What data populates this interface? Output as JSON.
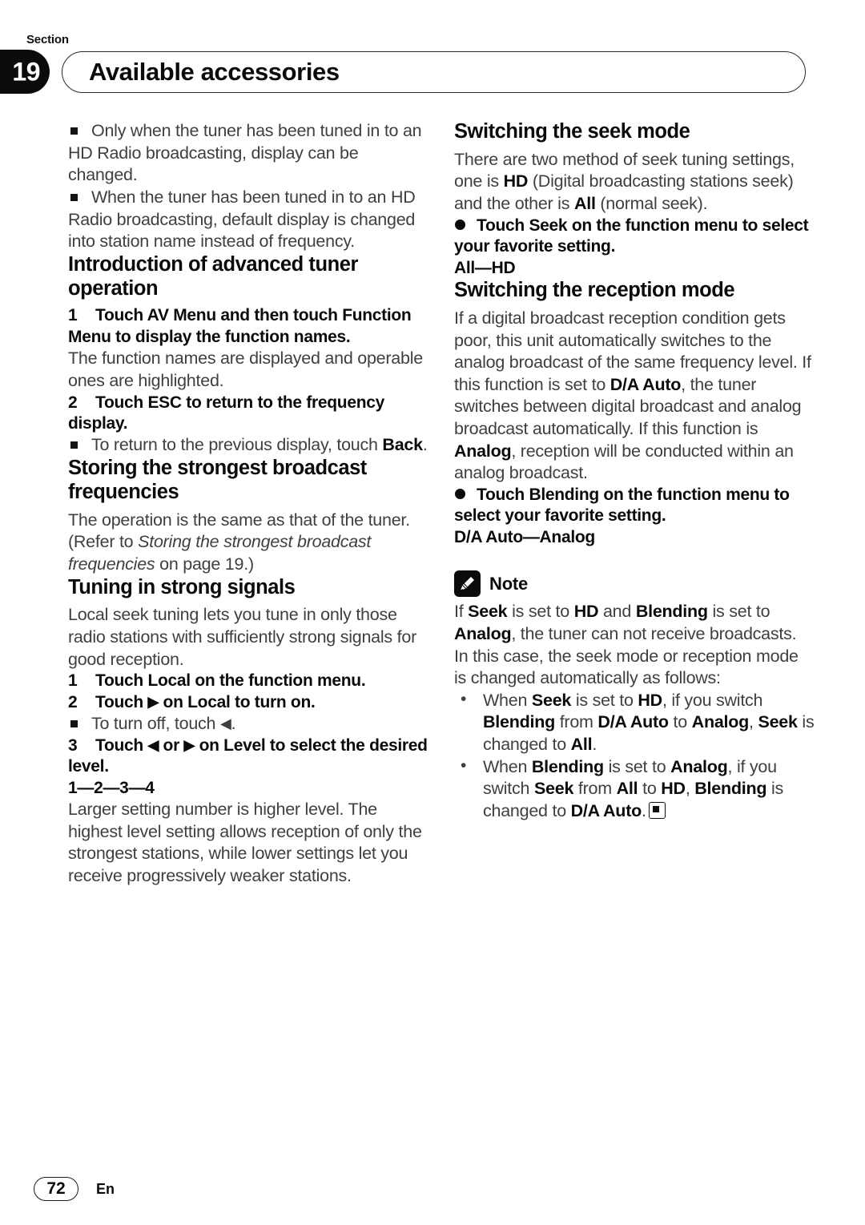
{
  "header": {
    "section_word": "Section",
    "section_number": "19",
    "title": "Available accessories"
  },
  "left_column": {
    "intro_bullets": [
      "Only when the tuner has been tuned in to an HD Radio broadcasting, display can be changed.",
      "When the tuner has been tuned in to an HD Radio broadcasting, default display is changed into station name instead of frequency."
    ],
    "section_advanced": {
      "heading": "Introduction of advanced tuner operation",
      "step1_number": "1",
      "step1_text": "Touch AV Menu and then touch Function Menu to display the function names.",
      "step1_body": "The function names are displayed and operable ones are highlighted.",
      "step2_number": "2",
      "step2_text": "Touch ESC to return to the frequency display.",
      "step2_bullet_pre": "To return to the previous display, touch ",
      "step2_bullet_bold": "Back",
      "step2_bullet_post": "."
    },
    "section_storing": {
      "heading": "Storing the strongest broadcast frequencies",
      "body_pre": "The operation is the same as that of the tuner. (Refer to ",
      "body_italic": "Storing the strongest broadcast frequencies",
      "body_post": " on page 19.)"
    },
    "section_tuning": {
      "heading": "Tuning in strong signals",
      "body": "Local seek tuning lets you tune in only those radio stations with sufficiently strong signals for good reception.",
      "step1_number": "1",
      "step1_text": "Touch Local on the function menu.",
      "step2_number": "2",
      "step2_pre": "Touch ",
      "step2_icon": "▶",
      "step2_post": " on Local to turn on.",
      "step2_bullet_pre": "To turn off, touch ",
      "step2_bullet_icon": "◀",
      "step2_bullet_post": ".",
      "step3_number": "3",
      "step3_pre": "Touch ",
      "step3_icon_left": "◀",
      "step3_mid": " or ",
      "step3_icon_right": "▶",
      "step3_post": " on Level to select the desired level.",
      "levels": "1—2—3—4",
      "levels_body": "Larger setting number is higher level. The highest level setting allows reception of only the strongest stations, while lower settings let you receive progressively weaker stations."
    }
  },
  "right_column": {
    "section_seek": {
      "heading": "Switching the seek mode",
      "body_1": "There are two method of seek tuning settings, one is ",
      "body_b1": "HD",
      "body_2": " (Digital broadcasting stations seek) and the other is ",
      "body_b2": "All",
      "body_3": " (normal seek).",
      "bullet_text": "Touch Seek on the function menu to select your favorite setting.",
      "options": "All—HD"
    },
    "section_reception": {
      "heading": "Switching the reception mode",
      "body_1": "If a digital broadcast reception condition gets poor, this unit automatically switches to the analog broadcast of the same frequency level. If this function is set to ",
      "body_b1": "D/A Auto",
      "body_2": ", the tuner switches between digital broadcast and analog broadcast automatically. If this function is ",
      "body_b2": "Analog",
      "body_3": ", reception will be conducted within an analog broadcast.",
      "bullet_text": "Touch Blending on the function menu to select your favorite setting.",
      "options": "D/A Auto—Analog"
    },
    "note": {
      "label": "Note",
      "icon": "pencil-icon",
      "intro_1": "If ",
      "intro_b1": "Seek",
      "intro_2": " is set to ",
      "intro_b2": "HD",
      "intro_3": " and ",
      "intro_b3": "Blending",
      "intro_4": " is set to ",
      "intro_b4": "Analog",
      "intro_5": ", the tuner can not receive broadcasts. In this case, the seek mode or reception mode is changed automatically as follows:",
      "bullet1": {
        "t1": "When ",
        "b1": "Seek",
        "t2": " is set to ",
        "b2": "HD",
        "t3": ", if you switch ",
        "b3": "Blending",
        "t4": " from ",
        "b4": "D/A Auto",
        "t5": " to ",
        "b5": "Analog",
        "t6": ", ",
        "b6": "Seek",
        "t7": " is changed to ",
        "b7": "All",
        "t8": "."
      },
      "bullet2": {
        "t1": "When ",
        "b1": "Blending",
        "t2": " is set to ",
        "b2": "Analog",
        "t3": ", if you switch ",
        "b3": "Seek",
        "t4": " from ",
        "b4": "All",
        "t5": " to ",
        "b5": "HD",
        "t6": ", ",
        "b6": "Blending",
        "t7": " is changed to ",
        "b7": "D/A Auto",
        "t8": "."
      }
    }
  },
  "footer": {
    "page_number": "72",
    "language": "En"
  }
}
